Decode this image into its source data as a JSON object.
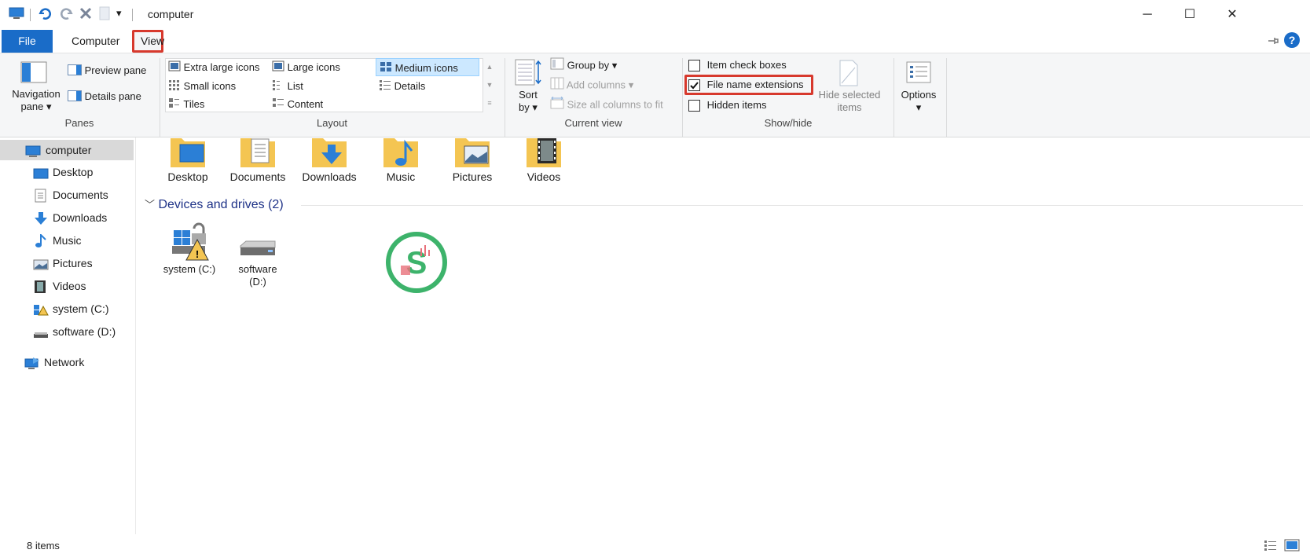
{
  "title_bar": {
    "title": "computer",
    "qa_down_arrow": "▾"
  },
  "window_controls": {
    "minimize": "─",
    "maximize": "☐",
    "close": "✕"
  },
  "tabs": {
    "file": "File",
    "computer": "Computer",
    "view": "View"
  },
  "ribbon": {
    "panes": {
      "navigation_pane": "Navigation",
      "navigation_pane2": "pane",
      "preview_pane": "Preview pane",
      "details_pane": "Details pane",
      "group_label": "Panes"
    },
    "layout": {
      "items": [
        "Extra large icons",
        "Large icons",
        "Medium icons",
        "Small icons",
        "List",
        "Details",
        "Tiles",
        "Content"
      ],
      "group_label": "Layout"
    },
    "current_view": {
      "sort_by": "Sort",
      "sort_by2": "by",
      "group_by": "Group by",
      "add_columns": "Add columns",
      "size_columns": "Size all columns to fit",
      "group_label": "Current view"
    },
    "show_hide": {
      "item_check_boxes": "Item check boxes",
      "file_name_extensions": "File name extensions",
      "hidden_items": "Hidden items",
      "hide_selected": "Hide selected",
      "hide_selected2": "items",
      "group_label": "Show/hide",
      "item_check_boxes_checked": false,
      "file_name_extensions_checked": true,
      "hidden_items_checked": false
    },
    "options": {
      "label": "Options"
    }
  },
  "nav": {
    "items": [
      "computer",
      "Desktop",
      "Documents",
      "Downloads",
      "Music",
      "Pictures",
      "Videos",
      "system (C:)",
      "software (D:)"
    ],
    "network": "Network"
  },
  "content": {
    "folders": [
      "Desktop",
      "Documents",
      "Downloads",
      "Music",
      "Pictures",
      "Videos"
    ],
    "devices_header": "Devices and drives (2)",
    "drives": [
      {
        "label": "system (C:)"
      },
      {
        "label": "software",
        "label2": "(D:)"
      }
    ]
  },
  "status_bar": {
    "items_count": "8 items"
  },
  "colors": {
    "accent": "#1a6cc8",
    "highlight_box": "#d7392d",
    "selected": "#cce8ff",
    "folder": "#f4c552"
  }
}
